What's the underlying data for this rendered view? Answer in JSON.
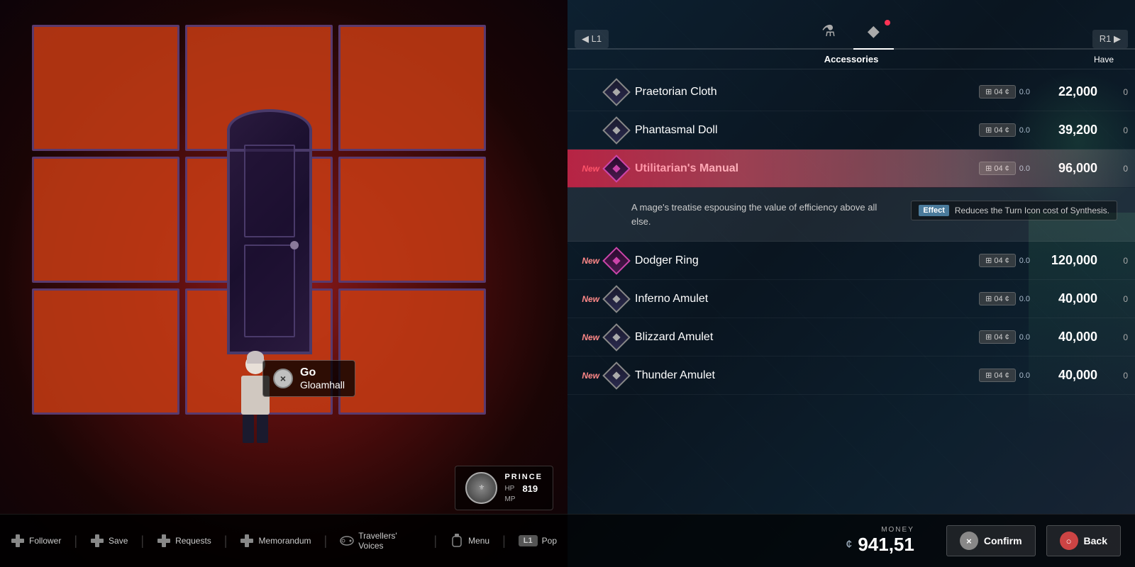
{
  "left_panel": {
    "prompt": {
      "button": "×",
      "action": "Go",
      "location": "Gloamhall"
    },
    "player": {
      "title": "Prince",
      "hp_label": "HP",
      "hp_value": "819",
      "mp_label": "MP"
    },
    "bottom_bar": {
      "buttons": [
        {
          "icon": "dpad",
          "label": "Follower"
        },
        {
          "icon": "dpad",
          "label": "Save"
        },
        {
          "icon": "dpad",
          "label": "Requests"
        },
        {
          "icon": "dpad",
          "label": "Memorandum"
        },
        {
          "icon": "controller",
          "label": "Travellers' Voices"
        },
        {
          "icon": "bottle",
          "label": "Menu"
        },
        {
          "icon": "l1",
          "label": "Pop"
        }
      ]
    }
  },
  "right_panel": {
    "tabs": [
      {
        "icon": "⚗",
        "label": "",
        "active": false
      },
      {
        "icon": "◆",
        "label": "",
        "active": true,
        "dot": true
      }
    ],
    "tab_arrows": {
      "left": "◀ L1",
      "right": "R1 ▶"
    },
    "category_label": "Accessories",
    "have_label": "Have",
    "items": [
      {
        "new": false,
        "name": "Praetorian Cloth",
        "diamond_type": "normal",
        "stock_label": "04",
        "currency": "0.0",
        "price": "22,000",
        "count": "0"
      },
      {
        "new": false,
        "name": "Phantasmal Doll",
        "diamond_type": "normal",
        "stock_label": "04",
        "currency": "0.0",
        "price": "39,200",
        "count": "0"
      },
      {
        "new": true,
        "name": "Utilitarian's Manual",
        "diamond_type": "pink",
        "stock_label": "04",
        "currency": "0.0",
        "price": "96,000",
        "count": "0",
        "selected": true,
        "description": "A mage's treatise espousing the value of efficiency above all else.",
        "effect_label": "Effect",
        "effect_text": "Reduces the Turn Icon cost of Synthesis."
      },
      {
        "new": true,
        "name": "Dodger Ring",
        "diamond_type": "pink",
        "stock_label": "04",
        "currency": "0.0",
        "price": "120,000",
        "count": "0"
      },
      {
        "new": true,
        "name": "Inferno Amulet",
        "diamond_type": "normal",
        "stock_label": "04",
        "currency": "0.0",
        "price": "40,000",
        "count": "0"
      },
      {
        "new": true,
        "name": "Blizzard Amulet",
        "diamond_type": "normal",
        "stock_label": "04",
        "currency": "0.0",
        "price": "40,000",
        "count": "0"
      },
      {
        "new": true,
        "name": "Thunder Amulet",
        "diamond_type": "normal",
        "stock_label": "04",
        "currency": "0.0",
        "price": "40,000",
        "count": "0"
      }
    ],
    "bottom": {
      "money_label": "MONEY",
      "money_currency": "¢",
      "money_value": "941,51",
      "confirm_btn": "Confirm",
      "back_btn": "Back"
    }
  }
}
